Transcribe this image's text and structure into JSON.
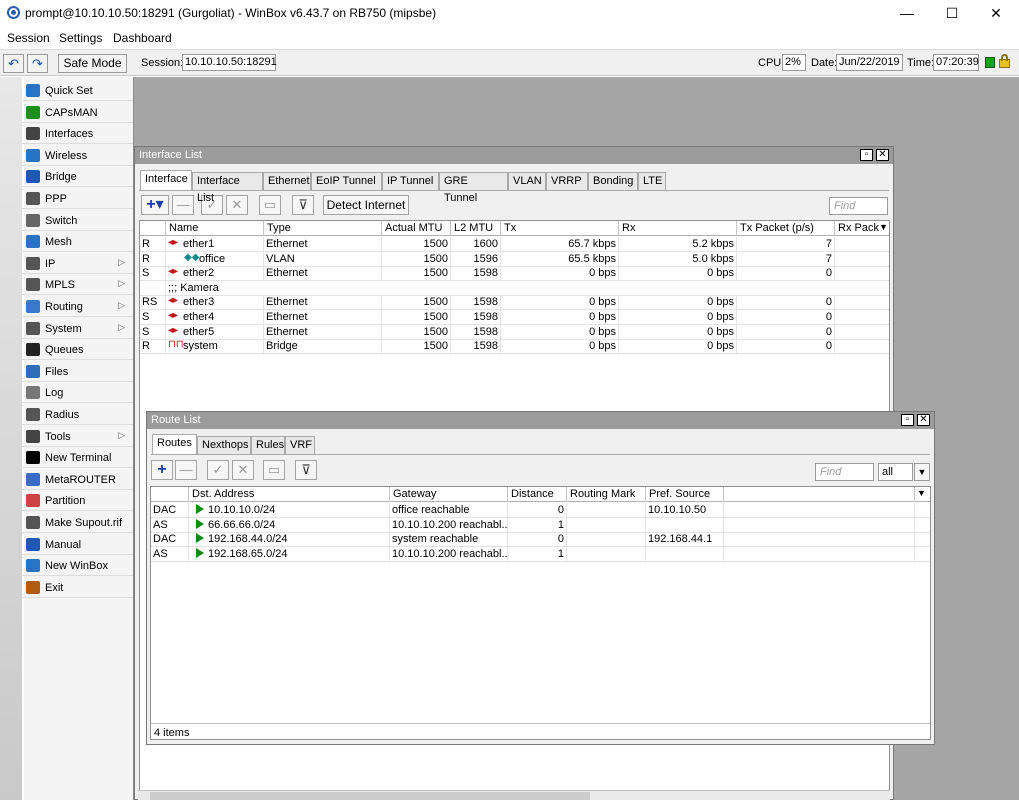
{
  "window": {
    "title": "prompt@10.10.10.50:18291 (Gurgoliat) - WinBox v6.43.7 on RB750 (mipsbe)",
    "minimize": "—",
    "maximize": "☐",
    "close": "✕"
  },
  "menu": {
    "session": "Session",
    "settings": "Settings",
    "dashboard": "Dashboard"
  },
  "toolbar": {
    "undo": "↶",
    "redo": "↷",
    "safe_mode": "Safe Mode",
    "session_label": "Session:",
    "session_value": "10.10.10.50:18291",
    "cpu_label": "CPU:",
    "cpu_value": "2%",
    "date_label": "Date:",
    "date_value": "Jun/22/2019",
    "time_label": "Time:",
    "time_value": "07:20:39"
  },
  "sidebar": {
    "items": [
      {
        "label": "Quick Set",
        "icon": "quickset-icon",
        "sub": false
      },
      {
        "label": "CAPsMAN",
        "icon": "capsman-icon",
        "sub": false
      },
      {
        "label": "Interfaces",
        "icon": "interfaces-icon",
        "sub": false
      },
      {
        "label": "Wireless",
        "icon": "wireless-icon",
        "sub": false
      },
      {
        "label": "Bridge",
        "icon": "bridge-icon",
        "sub": false
      },
      {
        "label": "PPP",
        "icon": "ppp-icon",
        "sub": false
      },
      {
        "label": "Switch",
        "icon": "switch-icon",
        "sub": false
      },
      {
        "label": "Mesh",
        "icon": "mesh-icon",
        "sub": false
      },
      {
        "label": "IP",
        "icon": "ip-icon",
        "sub": true
      },
      {
        "label": "MPLS",
        "icon": "mpls-icon",
        "sub": true
      },
      {
        "label": "Routing",
        "icon": "routing-icon",
        "sub": true
      },
      {
        "label": "System",
        "icon": "system-icon",
        "sub": true
      },
      {
        "label": "Queues",
        "icon": "queues-icon",
        "sub": false
      },
      {
        "label": "Files",
        "icon": "files-icon",
        "sub": false
      },
      {
        "label": "Log",
        "icon": "log-icon",
        "sub": false
      },
      {
        "label": "Radius",
        "icon": "radius-icon",
        "sub": false
      },
      {
        "label": "Tools",
        "icon": "tools-icon",
        "sub": true
      },
      {
        "label": "New Terminal",
        "icon": "terminal-icon",
        "sub": false
      },
      {
        "label": "MetaROUTER",
        "icon": "metarouter-icon",
        "sub": false
      },
      {
        "label": "Partition",
        "icon": "partition-icon",
        "sub": false
      },
      {
        "label": "Make Supout.rif",
        "icon": "supout-icon",
        "sub": false
      },
      {
        "label": "Manual",
        "icon": "manual-icon",
        "sub": false
      },
      {
        "label": "New WinBox",
        "icon": "newwinbox-icon",
        "sub": false
      },
      {
        "label": "Exit",
        "icon": "exit-icon",
        "sub": false
      }
    ]
  },
  "interface_list": {
    "title": "Interface List",
    "tabs": [
      "Interface",
      "Interface List",
      "Ethernet",
      "EoIP Tunnel",
      "IP Tunnel",
      "GRE Tunnel",
      "VLAN",
      "VRRP",
      "Bonding",
      "LTE"
    ],
    "detect_internet": "Detect Internet",
    "find_placeholder": "Find",
    "columns": [
      "",
      "Name",
      "Type",
      "Actual MTU",
      "L2 MTU",
      "Tx",
      "Rx",
      "Tx Packet (p/s)",
      "Rx Pack"
    ],
    "rows": [
      {
        "flag": "R",
        "name": "ether1",
        "type": "Ethernet",
        "mtu": "1500",
        "l2mtu": "1600",
        "tx": "65.7 kbps",
        "rx": "5.2 kbps",
        "txp": "7",
        "kind": "eth"
      },
      {
        "flag": "R",
        "name": "office",
        "type": "VLAN",
        "mtu": "1500",
        "l2mtu": "1596",
        "tx": "65.5 kbps",
        "rx": "5.0 kbps",
        "txp": "7",
        "kind": "vlan"
      },
      {
        "flag": "S",
        "name": "ether2",
        "type": "Ethernet",
        "mtu": "1500",
        "l2mtu": "1598",
        "tx": "0 bps",
        "rx": "0 bps",
        "txp": "0",
        "kind": "eth"
      },
      {
        "flag": "",
        "name": ";;; Kamera",
        "type": "",
        "mtu": "",
        "l2mtu": "",
        "tx": "",
        "rx": "",
        "txp": "",
        "kind": "comment"
      },
      {
        "flag": "RS",
        "name": "ether3",
        "type": "Ethernet",
        "mtu": "1500",
        "l2mtu": "1598",
        "tx": "0 bps",
        "rx": "0 bps",
        "txp": "0",
        "kind": "eth"
      },
      {
        "flag": "S",
        "name": "ether4",
        "type": "Ethernet",
        "mtu": "1500",
        "l2mtu": "1598",
        "tx": "0 bps",
        "rx": "0 bps",
        "txp": "0",
        "kind": "eth"
      },
      {
        "flag": "S",
        "name": "ether5",
        "type": "Ethernet",
        "mtu": "1500",
        "l2mtu": "1598",
        "tx": "0 bps",
        "rx": "0 bps",
        "txp": "0",
        "kind": "eth"
      },
      {
        "flag": "R",
        "name": "system",
        "type": "Bridge",
        "mtu": "1500",
        "l2mtu": "1598",
        "tx": "0 bps",
        "rx": "0 bps",
        "txp": "0",
        "kind": "bridge"
      }
    ]
  },
  "route_list": {
    "title": "Route List",
    "tabs": [
      "Routes",
      "Nexthops",
      "Rules",
      "VRF"
    ],
    "find_placeholder": "Find",
    "filter_value": "all",
    "columns": [
      "",
      "Dst. Address",
      "Gateway",
      "Distance",
      "Routing Mark",
      "Pref. Source"
    ],
    "rows": [
      {
        "flag": "DAC",
        "dst": "10.10.10.0/24",
        "gateway": "office reachable",
        "distance": "0",
        "mark": "",
        "pref": "10.10.10.50"
      },
      {
        "flag": "AS",
        "dst": "66.66.66.0/24",
        "gateway": "10.10.10.200 reachabl...",
        "distance": "1",
        "mark": "",
        "pref": ""
      },
      {
        "flag": "DAC",
        "dst": "192.168.44.0/24",
        "gateway": "system reachable",
        "distance": "0",
        "mark": "",
        "pref": "192.168.44.1"
      },
      {
        "flag": "AS",
        "dst": "192.168.65.0/24",
        "gateway": "10.10.10.200 reachabl...",
        "distance": "1",
        "mark": "",
        "pref": ""
      }
    ],
    "status": "4 items"
  }
}
